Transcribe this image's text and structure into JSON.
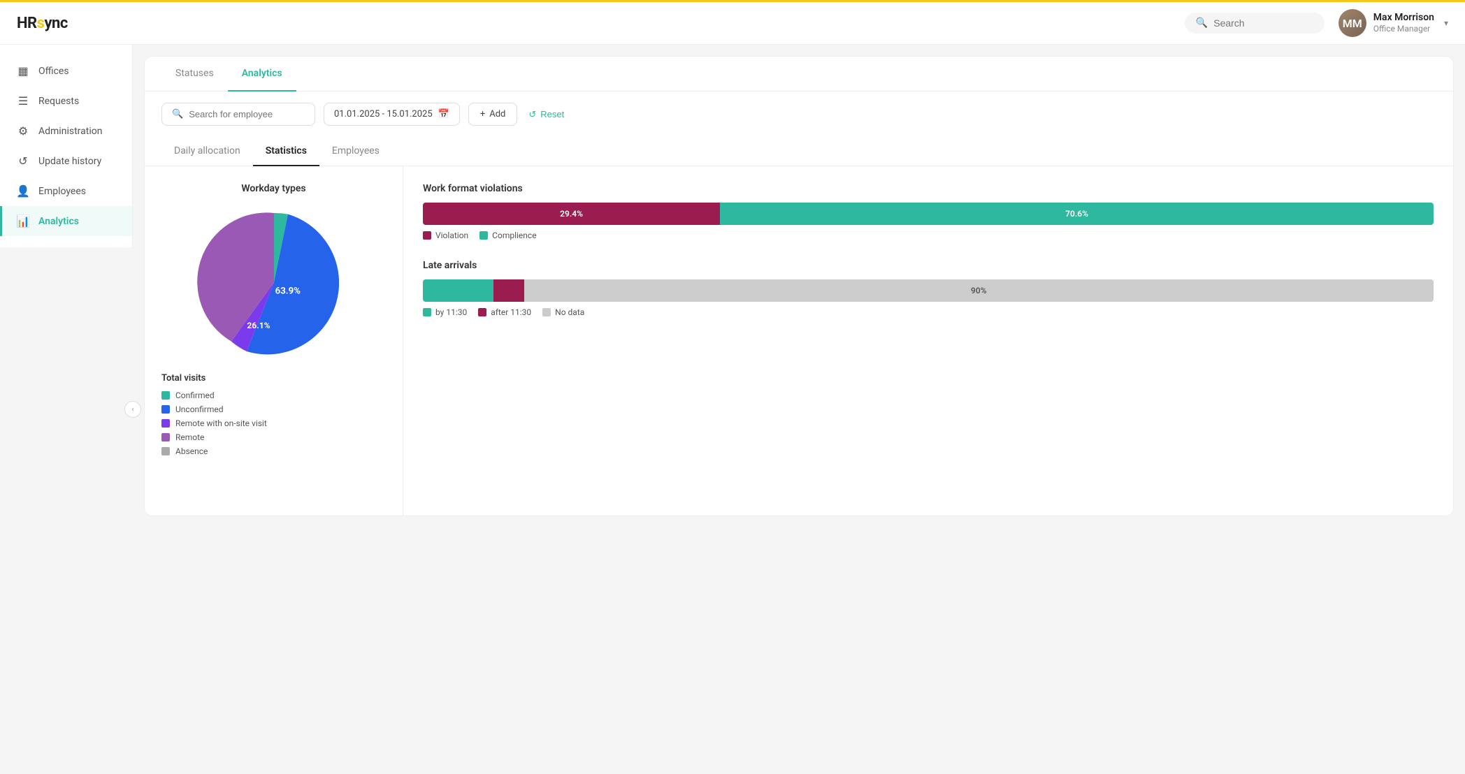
{
  "app": {
    "logo_text": "HRsync",
    "logo_dot": "·"
  },
  "topbar": {
    "search_placeholder": "Search",
    "user_name": "Max Morrison",
    "user_role": "Office Manager",
    "user_initials": "MM"
  },
  "sidebar": {
    "items": [
      {
        "id": "offices",
        "label": "Offices",
        "icon": "🏢",
        "active": false
      },
      {
        "id": "requests",
        "label": "Requests",
        "icon": "📋",
        "active": false
      },
      {
        "id": "administration",
        "label": "Administration",
        "icon": "⚙️",
        "active": false
      },
      {
        "id": "update-history",
        "label": "Update history",
        "icon": "🕐",
        "active": false
      },
      {
        "id": "employees",
        "label": "Employees",
        "icon": "👤",
        "active": false
      },
      {
        "id": "analytics",
        "label": "Analytics",
        "icon": "📊",
        "active": true
      }
    ]
  },
  "tabs": [
    {
      "id": "statuses",
      "label": "Statuses",
      "active": false
    },
    {
      "id": "analytics",
      "label": "Analytics",
      "active": true
    }
  ],
  "toolbar": {
    "search_placeholder": "Search for employee",
    "date_range": "01.01.2025 - 15.01.2025",
    "add_label": "Add",
    "reset_label": "Reset"
  },
  "sub_tabs": [
    {
      "id": "daily-allocation",
      "label": "Daily allocation",
      "active": false
    },
    {
      "id": "statistics",
      "label": "Statistics",
      "active": true
    },
    {
      "id": "employees",
      "label": "Employees",
      "active": false
    }
  ],
  "workday_chart": {
    "title": "Workday types",
    "segments": [
      {
        "label": "Confirmed",
        "color": "#2db89f",
        "percent": 5.1,
        "start_angle": 0
      },
      {
        "label": "Unconfirmed",
        "color": "#2563eb",
        "percent": 63.9,
        "start_angle": 18.36
      },
      {
        "label": "Remote with on-site visit",
        "color": "#7c3aed",
        "percent": 4.9,
        "start_angle": 248.4
      },
      {
        "label": "Remote",
        "color": "#9b59b6",
        "percent": 26.1,
        "start_angle": 266.04
      },
      {
        "label": "Absence",
        "color": "#aaa",
        "percent": 2.0,
        "start_angle": 359.8
      }
    ],
    "legend_title": "Total visits",
    "labels": {
      "unconfirmed_pct": "63.9%",
      "remote_pct": "26.1%"
    }
  },
  "work_format": {
    "title": "Work format violations",
    "violation_pct": 29.4,
    "compliance_pct": 70.6,
    "violation_label": "29.4%",
    "compliance_label": "70.6%",
    "legend": [
      {
        "label": "Violation",
        "color": "#9b1c4e"
      },
      {
        "label": "Complience",
        "color": "#2db89f"
      }
    ]
  },
  "late_arrivals": {
    "title": "Late arrivals",
    "by1130_pct": 7,
    "after1130_pct": 3,
    "nodata_pct": 90,
    "nodata_label": "90%",
    "legend": [
      {
        "label": "by 11:30",
        "color": "#2db89f"
      },
      {
        "label": "after 11:30",
        "color": "#9b1c4e"
      },
      {
        "label": "No data",
        "color": "#ccc"
      }
    ]
  }
}
